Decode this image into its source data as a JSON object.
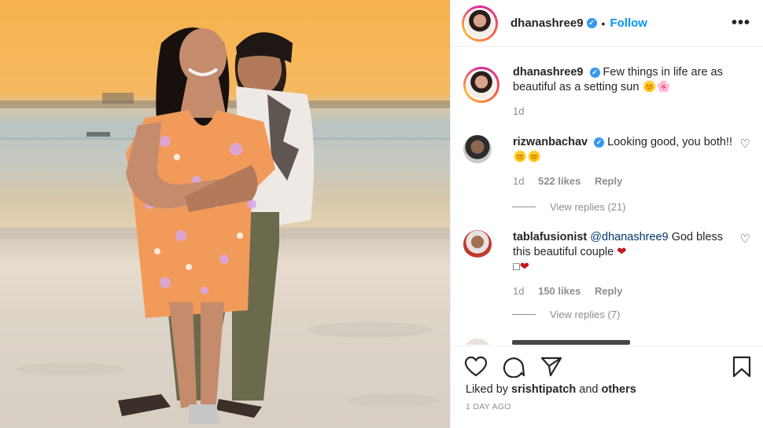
{
  "post": {
    "username": "dhanashree9",
    "follow_label": "Follow",
    "separator": "•",
    "more_label": "•••"
  },
  "caption": {
    "username": "dhanashree9",
    "text": "Few things in life are as beautiful as a setting sun",
    "emoji": "🌞🌸",
    "time": "1d"
  },
  "comments": [
    {
      "username": "rizwanbachav",
      "text": "Looking good, you both!!",
      "emoji": "🌞🌞",
      "time": "1d",
      "likes": "522 likes",
      "reply_label": "Reply",
      "view_replies": "View replies (21)"
    },
    {
      "username": "tablafusionist",
      "mention": "@dhanashree9",
      "text": "God bless this beautiful couple",
      "emoji": "❤",
      "emoji2": "❤",
      "glyph": "□",
      "time": "1d",
      "likes": "150 likes",
      "reply_label": "Reply",
      "view_replies": "View replies (7)"
    }
  ],
  "footer": {
    "liked_by_prefix": "Liked by",
    "liked_by_user": "srishtipatch",
    "liked_by_and": "and",
    "liked_by_others": "others",
    "timestamp": "1 DAY AGO"
  },
  "icons": {
    "like": "heart-icon",
    "comment": "comment-icon",
    "share": "paper-plane-icon",
    "save": "bookmark-icon"
  },
  "colors": {
    "follow": "#0095f6",
    "verified": "#3897f0",
    "muted": "#8e8e8e"
  }
}
